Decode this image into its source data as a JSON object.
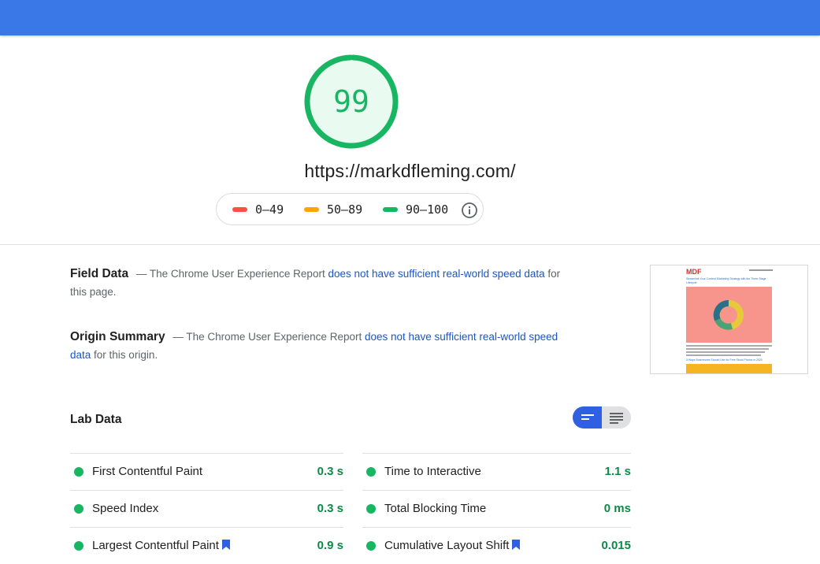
{
  "colors": {
    "header": "#3b78e7",
    "pass": "#18b663",
    "average": "#ffa400",
    "fail": "#ff4e42",
    "link": "#1a55c8"
  },
  "score": {
    "value": 99,
    "display": "99",
    "max": 100
  },
  "url": "https://markdfleming.com/",
  "legend": {
    "items": [
      {
        "label": "0–49",
        "color": "#ff4e42"
      },
      {
        "label": "50–89",
        "color": "#ffa400"
      },
      {
        "label": "90–100",
        "color": "#18b663"
      }
    ],
    "info_icon": "info-icon"
  },
  "field_data": {
    "title": "Field Data",
    "prefix": "— The Chrome User Experience Report",
    "link_text": "does not have sufficient real-world speed data",
    "suffix": "for this page."
  },
  "origin_summary": {
    "title": "Origin Summary",
    "prefix": "— The Chrome User Experience Report",
    "link_text": "does not have sufficient real-world speed data",
    "suffix": "for this origin."
  },
  "thumbnail": {
    "logo": "MDF",
    "headline": "Streamline Your Content Marketing Strategy with the Three Stage Lifecycle",
    "subhead": "3 Ways Businesses Should Use for Free Stock Photos in 2020"
  },
  "lab_data": {
    "title": "Lab Data",
    "toggle": {
      "active": "list-view-icon",
      "inactive": "text-view-icon"
    },
    "metrics_left": [
      {
        "label": "First Contentful Paint",
        "value": "0.3 s",
        "bookmark": false
      },
      {
        "label": "Speed Index",
        "value": "0.3 s",
        "bookmark": false
      },
      {
        "label": "Largest Contentful Paint",
        "value": "0.9 s",
        "bookmark": true
      }
    ],
    "metrics_right": [
      {
        "label": "Time to Interactive",
        "value": "1.1 s",
        "bookmark": false
      },
      {
        "label": "Total Blocking Time",
        "value": "0 ms",
        "bookmark": false
      },
      {
        "label": "Cumulative Layout Shift",
        "value": "0.015",
        "bookmark": true
      }
    ]
  }
}
